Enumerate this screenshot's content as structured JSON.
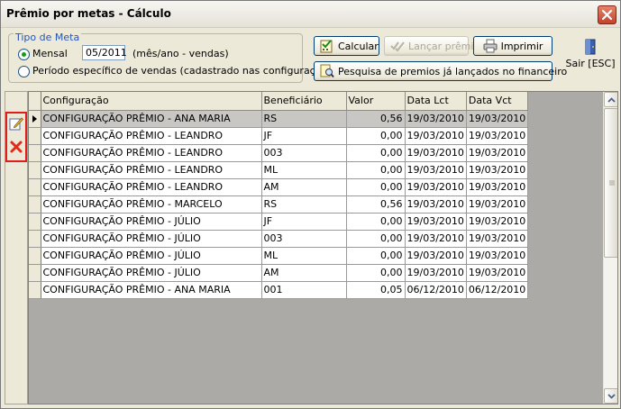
{
  "window": {
    "title": "Prêmio por metas - Cálculo"
  },
  "meta": {
    "legend": "Tipo de Meta",
    "mensal_label": "Mensal",
    "period_value": "05/2011",
    "period_hint": "(mês/ano - vendas)",
    "especifico_label": "Período específico de vendas (cadastrado nas configurações)",
    "selected": "mensal"
  },
  "toolbar": {
    "calcular": "Calcular",
    "lancar": "Lançar prêmio",
    "imprimir": "Imprimir",
    "pesquisa": "Pesquisa de premios já lançados no financeiro",
    "sair": "Sair [ESC]"
  },
  "grid": {
    "columns": [
      "Configuração",
      "Beneficiário",
      "Valor",
      "Data Lct",
      "Data Vct"
    ],
    "rows": [
      [
        "CONFIGURAÇÃO PRÊMIO - ANA MARIA",
        "RS",
        "0,56",
        "19/03/2010",
        "19/03/2010"
      ],
      [
        "CONFIGURAÇÃO PRÊMIO - LEANDRO",
        "JF",
        "0,00",
        "19/03/2010",
        "19/03/2010"
      ],
      [
        "CONFIGURAÇÃO PRÊMIO - LEANDRO",
        "003",
        "0,00",
        "19/03/2010",
        "19/03/2010"
      ],
      [
        "CONFIGURAÇÃO PRÊMIO - LEANDRO",
        "ML",
        "0,00",
        "19/03/2010",
        "19/03/2010"
      ],
      [
        "CONFIGURAÇÃO PRÊMIO - LEANDRO",
        "AM",
        "0,00",
        "19/03/2010",
        "19/03/2010"
      ],
      [
        "CONFIGURAÇÃO PRÊMIO - MARCELO",
        "RS",
        "0,56",
        "19/03/2010",
        "19/03/2010"
      ],
      [
        "CONFIGURAÇÃO PRÊMIO - JÚLIO",
        "JF",
        "0,00",
        "19/03/2010",
        "19/03/2010"
      ],
      [
        "CONFIGURAÇÃO PRÊMIO - JÚLIO",
        "003",
        "0,00",
        "19/03/2010",
        "19/03/2010"
      ],
      [
        "CONFIGURAÇÃO PRÊMIO - JÚLIO",
        "ML",
        "0,00",
        "19/03/2010",
        "19/03/2010"
      ],
      [
        "CONFIGURAÇÃO PRÊMIO - JÚLIO",
        "AM",
        "0,00",
        "19/03/2010",
        "19/03/2010"
      ],
      [
        "CONFIGURAÇÃO PRÊMIO - ANA MARIA",
        "001",
        "0,05",
        "06/12/2010",
        "06/12/2010"
      ]
    ],
    "selected_row": 0
  },
  "tools": {
    "edit_icon": "edit-icon",
    "delete_icon": "delete-icon"
  },
  "colors": {
    "highlight_border": "#e21b1b",
    "selected_row": "#c8c7c3",
    "legend": "#2356b8"
  }
}
